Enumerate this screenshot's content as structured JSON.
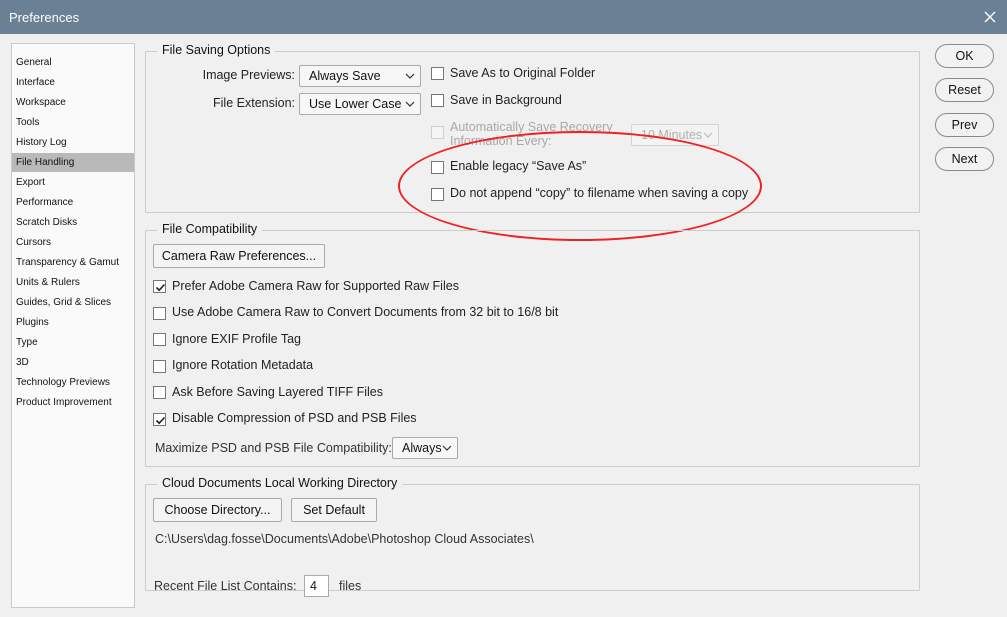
{
  "window": {
    "title": "Preferences"
  },
  "sidebar": {
    "items": [
      {
        "label": "General"
      },
      {
        "label": "Interface"
      },
      {
        "label": "Workspace"
      },
      {
        "label": "Tools"
      },
      {
        "label": "History Log"
      },
      {
        "label": "File Handling",
        "selected": true
      },
      {
        "label": "Export"
      },
      {
        "label": "Performance"
      },
      {
        "label": "Scratch Disks"
      },
      {
        "label": "Cursors"
      },
      {
        "label": "Transparency & Gamut"
      },
      {
        "label": "Units & Rulers"
      },
      {
        "label": "Guides, Grid & Slices"
      },
      {
        "label": "Plugins"
      },
      {
        "label": "Type"
      },
      {
        "label": "3D"
      },
      {
        "label": "Technology Previews"
      },
      {
        "label": "Product Improvement"
      }
    ]
  },
  "file_saving": {
    "legend": "File Saving Options",
    "image_previews_label": "Image Previews:",
    "image_previews_value": "Always Save",
    "file_extension_label": "File Extension:",
    "file_extension_value": "Use Lower Case",
    "save_as_original_label": "Save As to Original Folder",
    "save_as_original_checked": false,
    "save_in_background_label": "Save in Background",
    "save_in_background_checked": false,
    "auto_save_label_line1": "Automatically Save Recovery",
    "auto_save_label_line2": "Information Every:",
    "auto_save_value": "10 Minutes",
    "auto_save_enabled": false,
    "legacy_save_as_label": "Enable legacy “Save As”",
    "legacy_save_as_checked": false,
    "no_copy_label": "Do not append “copy” to filename when saving a copy",
    "no_copy_checked": false
  },
  "file_compat": {
    "legend": "File Compatibility",
    "camera_raw_button": "Camera Raw Preferences...",
    "prefer_acr_label": "Prefer Adobe Camera Raw for Supported Raw Files",
    "prefer_acr_checked": true,
    "use_acr_label": "Use Adobe Camera Raw to Convert Documents from 32 bit to 16/8 bit",
    "use_acr_checked": false,
    "ignore_exif_label": "Ignore EXIF Profile Tag",
    "ignore_exif_checked": false,
    "ignore_rotation_label": "Ignore Rotation Metadata",
    "ignore_rotation_checked": false,
    "ask_tiff_label": "Ask Before Saving Layered TIFF Files",
    "ask_tiff_checked": false,
    "disable_compression_label": "Disable Compression of PSD and PSB Files",
    "disable_compression_checked": true,
    "maximize_label": "Maximize PSD and PSB File Compatibility:",
    "maximize_value": "Always"
  },
  "cloud": {
    "legend": "Cloud Documents Local Working Directory",
    "choose_button": "Choose Directory...",
    "default_button": "Set Default",
    "path": "C:\\Users\\dag.fosse\\Documents\\Adobe\\Photoshop Cloud Associates\\"
  },
  "recent": {
    "label": "Recent File List Contains:",
    "value": "4",
    "suffix": "files"
  },
  "buttons": {
    "ok": "OK",
    "reset": "Reset",
    "prev": "Prev",
    "next": "Next"
  },
  "colors": {
    "titlebar": "#6b7f95",
    "annotation": "#e22222",
    "selected_item": "#b9b9b9"
  }
}
